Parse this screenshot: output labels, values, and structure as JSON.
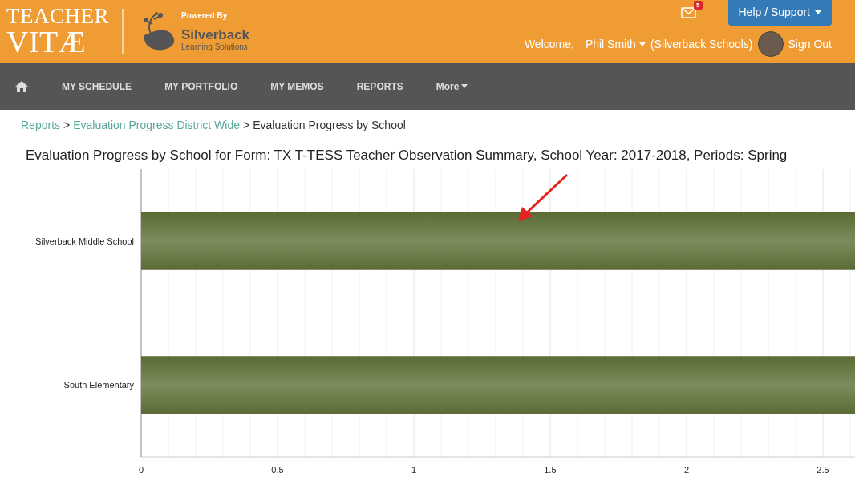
{
  "header": {
    "logo_lines": [
      "TEACHER",
      "VITÆ"
    ],
    "powered_by": "Powered By",
    "partner_name": "Silverback",
    "partner_tagline": "Learning Solutions",
    "mail_badge": "5",
    "help_button": "Help / Support",
    "welcome": "Welcome,",
    "user_name": "Phil Smith",
    "organization": "(Silverback Schools)",
    "sign_out": "Sign Out"
  },
  "nav": {
    "items": [
      {
        "label": "MY SCHEDULE",
        "kind": "link"
      },
      {
        "label": "MY PORTFOLIO",
        "kind": "link"
      },
      {
        "label": "MY MEMOS",
        "kind": "link"
      },
      {
        "label": "REPORTS",
        "kind": "link"
      },
      {
        "label": "More",
        "kind": "dropdown"
      }
    ]
  },
  "breadcrumb": [
    {
      "label": "Reports",
      "kind": "link"
    },
    {
      "label": "Evaluation Progress District Wide",
      "kind": "link"
    },
    {
      "label": "Evaluation Progress by School",
      "kind": "current"
    }
  ],
  "separator": ">",
  "chart": {
    "title": "Evaluation Progress by School for Form: TX T-TESS Teacher Observation Summary, School Year: 2017-2018, Periods: Spring",
    "categories": [
      "Silverback Middle School",
      "South Elementary"
    ],
    "x_tick_labels": [
      "0",
      "0.5",
      "1",
      "1.5",
      "2",
      "2.5"
    ]
  }
}
